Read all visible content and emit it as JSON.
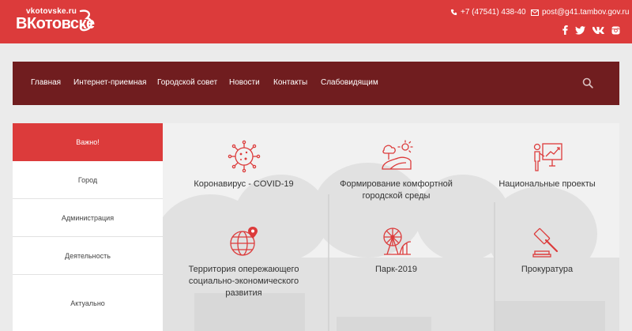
{
  "header": {
    "logo_domain": "vkotovske.ru",
    "logo_text": "ВКотовске",
    "phone": "+7 (47541) 438-40",
    "email": "post@g41.tambov.gov.ru",
    "social": [
      "facebook-icon",
      "twitter-icon",
      "vk-icon",
      "instagram-icon"
    ]
  },
  "nav": {
    "items": [
      "Главная",
      "Интернет-приемная",
      "Городской совет",
      "Новости",
      "Контакты",
      "Слабовидящим"
    ]
  },
  "sidebar": {
    "items": [
      "Важно!",
      "Город",
      "Администрация",
      "Деятельность",
      "Актуально"
    ],
    "active_index": 0
  },
  "tiles": [
    {
      "label": "Коронавирус - COVID-19",
      "icon": "virus-icon"
    },
    {
      "label": "Формирование комфортной городской среды",
      "icon": "landscape-icon"
    },
    {
      "label": "Национальные проекты",
      "icon": "presentation-icon"
    },
    {
      "label": "Территория опережающего социально-экономического развития",
      "icon": "globe-pin-icon"
    },
    {
      "label": "Парк-2019",
      "icon": "ferris-wheel-icon"
    },
    {
      "label": "Прокуратура",
      "icon": "gavel-icon"
    }
  ],
  "colors": {
    "accent": "#dc3b3b",
    "nav": "#701d1f"
  }
}
